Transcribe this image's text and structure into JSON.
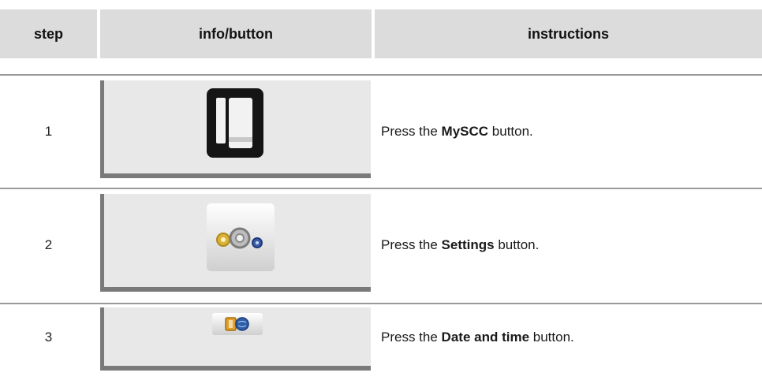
{
  "header": {
    "step": "step",
    "info": "info/button",
    "instructions": "instructions"
  },
  "rows": [
    {
      "step": "1",
      "icon": "myscc-oven-icon",
      "instr_pre": "Press the ",
      "instr_bold": "MySCC",
      "instr_post": " button."
    },
    {
      "step": "2",
      "icon": "settings-gears-icon",
      "instr_pre": "Press the ",
      "instr_bold": "Settings",
      "instr_post": " button."
    },
    {
      "step": "3",
      "icon": "date-time-icon",
      "instr_pre": "Press the ",
      "instr_bold": "Date and time",
      "instr_post": " button."
    }
  ]
}
